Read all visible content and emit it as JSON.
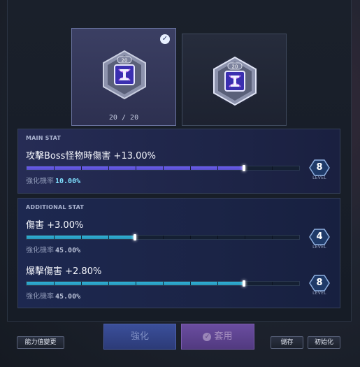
{
  "item_cards": {
    "left": {
      "badge": "20",
      "count_current": "20",
      "count_sep": "/",
      "count_total": "20",
      "selected": true
    },
    "right": {
      "badge": "20"
    }
  },
  "main_stat": {
    "section_title": "MAIN STAT",
    "stat_label": "攻擊Boss怪物時傷害 +13.00%",
    "rate_label": "強化機率",
    "rate_value": "10.00%",
    "progress": 0.8,
    "level": "8",
    "level_label": "LEVEL",
    "bar_color": "#6a5cf0"
  },
  "additional_stat": {
    "section_title": "ADDITIONAL STAT",
    "stats": [
      {
        "stat_label": "傷害 +3.00%",
        "rate_label": "強化機率",
        "rate_value": "45.00%",
        "progress": 0.4,
        "level": "4",
        "level_label": "LEVEL"
      },
      {
        "stat_label": "爆擊傷害 +2.80%",
        "rate_label": "強化機率",
        "rate_value": "45.00%",
        "progress": 0.8,
        "level": "8",
        "level_label": "LEVEL"
      }
    ],
    "bar_color": "#2fb2d8"
  },
  "buttons": {
    "stat_change": "能力值變更",
    "strengthen": "強化",
    "apply": "套用",
    "save": "儲存",
    "reset": "初始化"
  },
  "colors": {
    "main_rate_value": "#7fe0ff",
    "add_rate_value": "#b8c0d6",
    "accent_purple": "#6a4da0",
    "accent_blue": "#3b4f9a"
  },
  "icons": [
    "check-icon",
    "gem-icon",
    "apply-check-icon",
    "level-hexagon-icon"
  ]
}
